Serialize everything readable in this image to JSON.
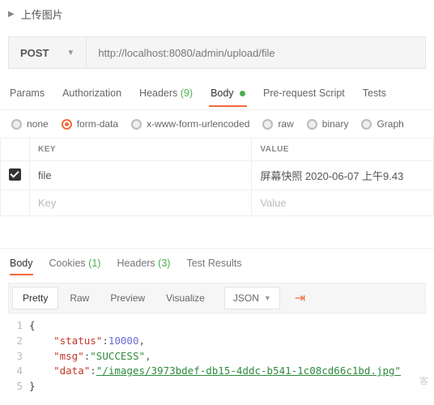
{
  "collapse_title": "上传图片",
  "method": "POST",
  "url": "http://localhost:8080/admin/upload/file",
  "request_tabs": {
    "params": "Params",
    "authorization": "Authorization",
    "headers_label": "Headers",
    "headers_count": "(9)",
    "body": "Body",
    "prerequest": "Pre-request Script",
    "tests": "Tests"
  },
  "body_types": {
    "none": "none",
    "form_data": "form-data",
    "x_www": "x-www-form-urlencoded",
    "raw": "raw",
    "binary": "binary",
    "graph": "Graph"
  },
  "form_table": {
    "header_key": "KEY",
    "header_value": "VALUE",
    "rows": [
      {
        "key": "file",
        "value": "屏幕快照 2020-06-07 上午9.43"
      }
    ],
    "placeholder_key": "Key",
    "placeholder_value": "Value"
  },
  "response_tabs": {
    "body": "Body",
    "cookies_label": "Cookies",
    "cookies_count": "(1)",
    "headers_label": "Headers",
    "headers_count": "(3)",
    "test_results": "Test Results"
  },
  "viewer": {
    "pretty": "Pretty",
    "raw": "Raw",
    "preview": "Preview",
    "visualize": "Visualize",
    "format": "JSON"
  },
  "json_body": {
    "l1": "{",
    "k_status": "\"status\"",
    "v_status": "10000",
    "k_msg": "\"msg\"",
    "v_msg": "\"SUCCESS\"",
    "k_data": "\"data\"",
    "v_data": "\"/images/3973bdef-db15-4ddc-b541-1c08cd66c1bd.jpg\"",
    "l5": "}",
    "comma": ","
  },
  "watermark": "客"
}
